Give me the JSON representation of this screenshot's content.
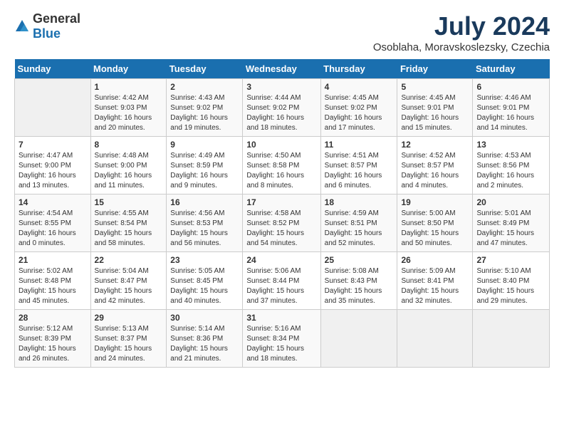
{
  "logo": {
    "general": "General",
    "blue": "Blue"
  },
  "title": "July 2024",
  "subtitle": "Osoblaha, Moravskoslezsky, Czechia",
  "header": {
    "days": [
      "Sunday",
      "Monday",
      "Tuesday",
      "Wednesday",
      "Thursday",
      "Friday",
      "Saturday"
    ]
  },
  "weeks": [
    [
      {
        "num": "",
        "info": ""
      },
      {
        "num": "1",
        "info": "Sunrise: 4:42 AM\nSunset: 9:03 PM\nDaylight: 16 hours\nand 20 minutes."
      },
      {
        "num": "2",
        "info": "Sunrise: 4:43 AM\nSunset: 9:02 PM\nDaylight: 16 hours\nand 19 minutes."
      },
      {
        "num": "3",
        "info": "Sunrise: 4:44 AM\nSunset: 9:02 PM\nDaylight: 16 hours\nand 18 minutes."
      },
      {
        "num": "4",
        "info": "Sunrise: 4:45 AM\nSunset: 9:02 PM\nDaylight: 16 hours\nand 17 minutes."
      },
      {
        "num": "5",
        "info": "Sunrise: 4:45 AM\nSunset: 9:01 PM\nDaylight: 16 hours\nand 15 minutes."
      },
      {
        "num": "6",
        "info": "Sunrise: 4:46 AM\nSunset: 9:01 PM\nDaylight: 16 hours\nand 14 minutes."
      }
    ],
    [
      {
        "num": "7",
        "info": "Sunrise: 4:47 AM\nSunset: 9:00 PM\nDaylight: 16 hours\nand 13 minutes."
      },
      {
        "num": "8",
        "info": "Sunrise: 4:48 AM\nSunset: 9:00 PM\nDaylight: 16 hours\nand 11 minutes."
      },
      {
        "num": "9",
        "info": "Sunrise: 4:49 AM\nSunset: 8:59 PM\nDaylight: 16 hours\nand 9 minutes."
      },
      {
        "num": "10",
        "info": "Sunrise: 4:50 AM\nSunset: 8:58 PM\nDaylight: 16 hours\nand 8 minutes."
      },
      {
        "num": "11",
        "info": "Sunrise: 4:51 AM\nSunset: 8:57 PM\nDaylight: 16 hours\nand 6 minutes."
      },
      {
        "num": "12",
        "info": "Sunrise: 4:52 AM\nSunset: 8:57 PM\nDaylight: 16 hours\nand 4 minutes."
      },
      {
        "num": "13",
        "info": "Sunrise: 4:53 AM\nSunset: 8:56 PM\nDaylight: 16 hours\nand 2 minutes."
      }
    ],
    [
      {
        "num": "14",
        "info": "Sunrise: 4:54 AM\nSunset: 8:55 PM\nDaylight: 16 hours\nand 0 minutes."
      },
      {
        "num": "15",
        "info": "Sunrise: 4:55 AM\nSunset: 8:54 PM\nDaylight: 15 hours\nand 58 minutes."
      },
      {
        "num": "16",
        "info": "Sunrise: 4:56 AM\nSunset: 8:53 PM\nDaylight: 15 hours\nand 56 minutes."
      },
      {
        "num": "17",
        "info": "Sunrise: 4:58 AM\nSunset: 8:52 PM\nDaylight: 15 hours\nand 54 minutes."
      },
      {
        "num": "18",
        "info": "Sunrise: 4:59 AM\nSunset: 8:51 PM\nDaylight: 15 hours\nand 52 minutes."
      },
      {
        "num": "19",
        "info": "Sunrise: 5:00 AM\nSunset: 8:50 PM\nDaylight: 15 hours\nand 50 minutes."
      },
      {
        "num": "20",
        "info": "Sunrise: 5:01 AM\nSunset: 8:49 PM\nDaylight: 15 hours\nand 47 minutes."
      }
    ],
    [
      {
        "num": "21",
        "info": "Sunrise: 5:02 AM\nSunset: 8:48 PM\nDaylight: 15 hours\nand 45 minutes."
      },
      {
        "num": "22",
        "info": "Sunrise: 5:04 AM\nSunset: 8:47 PM\nDaylight: 15 hours\nand 42 minutes."
      },
      {
        "num": "23",
        "info": "Sunrise: 5:05 AM\nSunset: 8:45 PM\nDaylight: 15 hours\nand 40 minutes."
      },
      {
        "num": "24",
        "info": "Sunrise: 5:06 AM\nSunset: 8:44 PM\nDaylight: 15 hours\nand 37 minutes."
      },
      {
        "num": "25",
        "info": "Sunrise: 5:08 AM\nSunset: 8:43 PM\nDaylight: 15 hours\nand 35 minutes."
      },
      {
        "num": "26",
        "info": "Sunrise: 5:09 AM\nSunset: 8:41 PM\nDaylight: 15 hours\nand 32 minutes."
      },
      {
        "num": "27",
        "info": "Sunrise: 5:10 AM\nSunset: 8:40 PM\nDaylight: 15 hours\nand 29 minutes."
      }
    ],
    [
      {
        "num": "28",
        "info": "Sunrise: 5:12 AM\nSunset: 8:39 PM\nDaylight: 15 hours\nand 26 minutes."
      },
      {
        "num": "29",
        "info": "Sunrise: 5:13 AM\nSunset: 8:37 PM\nDaylight: 15 hours\nand 24 minutes."
      },
      {
        "num": "30",
        "info": "Sunrise: 5:14 AM\nSunset: 8:36 PM\nDaylight: 15 hours\nand 21 minutes."
      },
      {
        "num": "31",
        "info": "Sunrise: 5:16 AM\nSunset: 8:34 PM\nDaylight: 15 hours\nand 18 minutes."
      },
      {
        "num": "",
        "info": ""
      },
      {
        "num": "",
        "info": ""
      },
      {
        "num": "",
        "info": ""
      }
    ]
  ]
}
